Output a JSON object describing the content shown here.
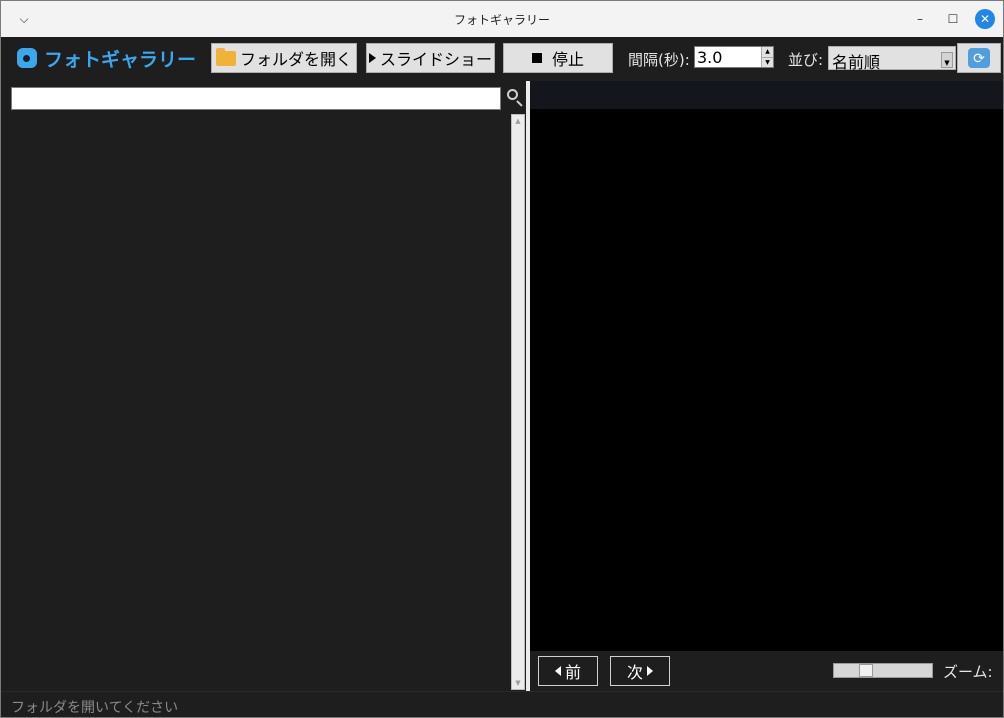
{
  "window": {
    "title": "フォトギャラリー",
    "controls": {
      "menu": "⌵",
      "minimize": "–",
      "maximize": "☐",
      "close": "✕"
    }
  },
  "toolbar": {
    "app_name": "フォトギャラリー",
    "open_folder_label": "フォルダを開く",
    "slideshow_label": "スライドショー",
    "stop_label": "停止",
    "interval_label": "間隔(秒):",
    "interval_value": "3.0",
    "sort_label": "並び:",
    "sort_value": "名前順",
    "refresh_icon": "refresh-icon"
  },
  "left_panel": {
    "search_value": "",
    "search_icon": "magnifier-icon"
  },
  "viewer": {
    "prev_label": "前",
    "next_label": "次",
    "zoom_label": "ズーム:",
    "zoom_fraction": 0.3
  },
  "status": {
    "text": "フォルダを開いてください"
  },
  "colors": {
    "accent": "#3aa7ef",
    "background": "#1e1e1e",
    "viewer": "#000000",
    "close_button": "#1f87e6"
  }
}
